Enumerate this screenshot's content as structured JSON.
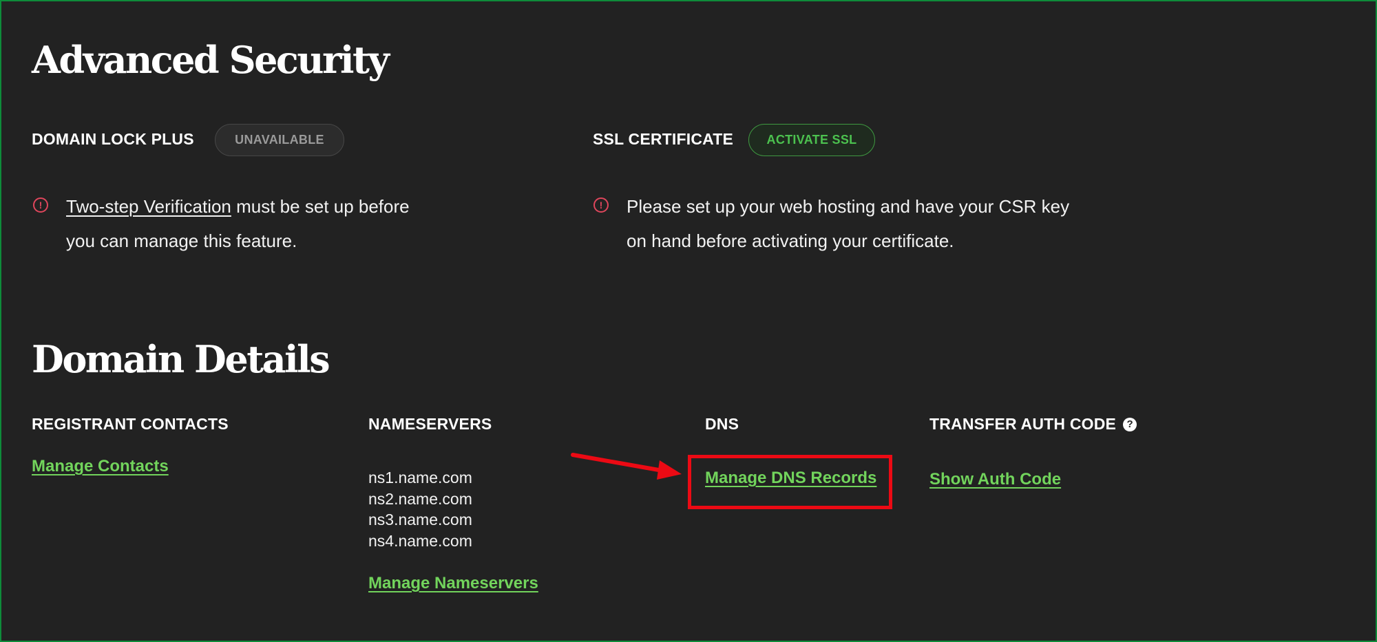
{
  "advanced_security": {
    "title": "Advanced Security",
    "domain_lock": {
      "label": "DOMAIN LOCK PLUS",
      "status": "UNAVAILABLE",
      "icon": "alert-circle-icon",
      "note_link": "Two-step Verification",
      "note_line1_rest": " must be set up before",
      "note_line2": "you can manage this feature."
    },
    "ssl": {
      "label": "SSL CERTIFICATE",
      "button": "ACTIVATE SSL",
      "icon": "alert-circle-icon",
      "note_line1": "Please set up your web hosting and have your CSR key",
      "note_line2": "on hand before activating your certificate."
    }
  },
  "domain_details": {
    "title": "Domain Details",
    "registrant": {
      "label": "REGISTRANT CONTACTS",
      "link": "Manage Contacts"
    },
    "nameservers": {
      "label": "NAMESERVERS",
      "items": [
        "ns1.name.com",
        "ns2.name.com",
        "ns3.name.com",
        "ns4.name.com"
      ],
      "link": "Manage Nameservers"
    },
    "dns": {
      "label": "DNS",
      "link": "Manage DNS Records"
    },
    "transfer": {
      "label": "TRANSFER AUTH CODE",
      "help_icon": "question-circle-icon",
      "help_glyph": "?",
      "link": "Show Auth Code"
    }
  },
  "colors": {
    "background": "#222222",
    "link_green": "#72d45c",
    "ssl_green": "#4cc24f",
    "alert_red": "#e0465c",
    "annotation_red": "#ec0a14",
    "frame_green": "#0e8c3a"
  }
}
